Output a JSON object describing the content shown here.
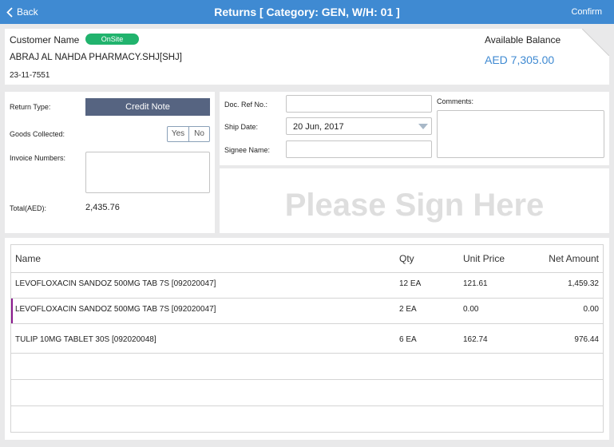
{
  "topbar": {
    "back_label": "Back",
    "title": "Returns [ Category: GEN, W/H: 01 ]",
    "confirm_label": "Confirm"
  },
  "customer": {
    "label": "Customer Name",
    "badge": "OnSite",
    "name": "ABRAJ AL NAHDA PHARMACY.SHJ[SHJ]",
    "id": "23-11-7551",
    "balance_label": "Available Balance",
    "balance_value": "AED 7,305.00"
  },
  "form": {
    "return_type_label": "Return Type:",
    "return_type_value": "Credit Note",
    "goods_collected_label": "Goods Collected:",
    "yes_label": "Yes",
    "no_label": "No",
    "invoice_numbers_label": "Invoice Numbers:",
    "total_label": "Total(AED):",
    "total_value": "2,435.76",
    "doc_ref_label": "Doc. Ref No.:",
    "doc_ref_value": "",
    "ship_date_label": "Ship Date:",
    "ship_date_value": "20 Jun, 2017",
    "signee_label": "Signee Name:",
    "signee_value": "",
    "comments_label": "Comments:",
    "comments_value": ""
  },
  "signature": {
    "placeholder": "Please Sign Here"
  },
  "table": {
    "headers": {
      "name": "Name",
      "qty": "Qty",
      "unit_price": "Unit Price",
      "net_amount": "Net Amount"
    },
    "rows": [
      {
        "name": "LEVOFLOXACIN SANDOZ 500MG TAB 7S [092020047]",
        "qty": "12 EA",
        "unit_price": "121.61",
        "net_amount": "1,459.32"
      },
      {
        "name": "LEVOFLOXACIN SANDOZ 500MG TAB 7S [092020047]",
        "qty": "2 EA",
        "unit_price": "0.00",
        "net_amount": "0.00"
      },
      {
        "name": "TULIP 10MG TABLET 30S [092020048]",
        "qty": "6 EA",
        "unit_price": "162.74",
        "net_amount": "976.44"
      }
    ]
  },
  "colors": {
    "topbar": "#3f8ad2",
    "badge": "#21b36d",
    "button": "#566481",
    "selected_row_marker": "#8b1a8e"
  },
  "icons": {
    "back": "chevron-left-icon",
    "ship_date_dropdown": "triangle-down-icon"
  }
}
